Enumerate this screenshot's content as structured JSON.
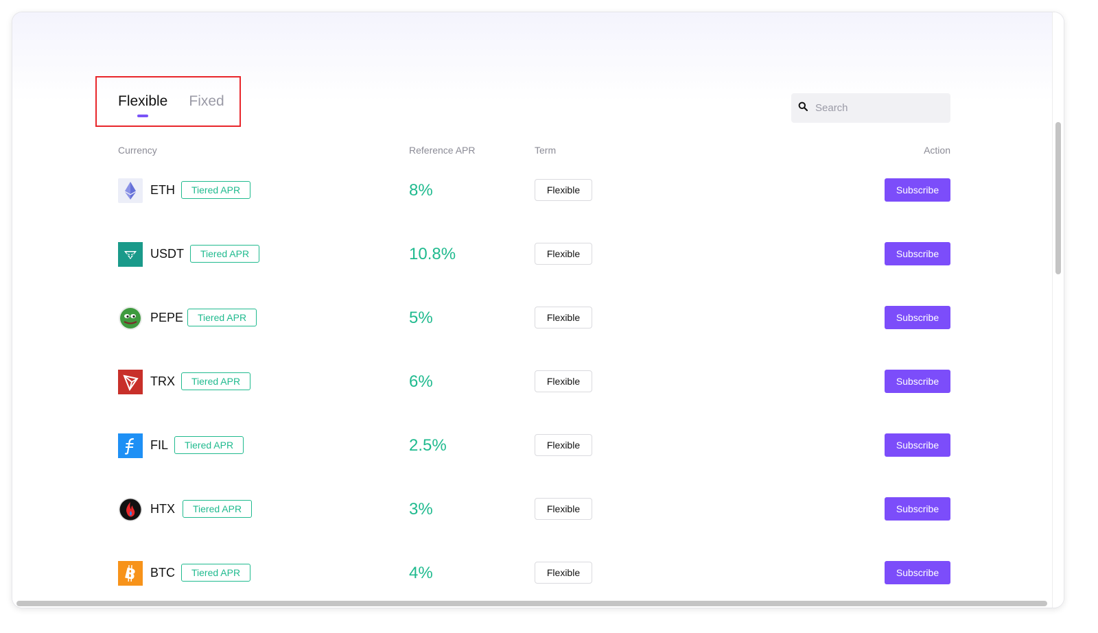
{
  "tabs": {
    "items": [
      {
        "label": "Flexible",
        "active": true
      },
      {
        "label": "Fixed",
        "active": false
      }
    ]
  },
  "search": {
    "placeholder": "Search",
    "value": ""
  },
  "table": {
    "headers": {
      "currency": "Currency",
      "apr": "Reference APR",
      "term": "Term",
      "action": "Action"
    },
    "rows": [
      {
        "symbol": "ETH",
        "badge": "Tiered APR",
        "apr": "8%",
        "term": "Flexible",
        "action": "Subscribe",
        "icon": "eth-icon"
      },
      {
        "symbol": "USDT",
        "badge": "Tiered APR",
        "apr": "10.8%",
        "term": "Flexible",
        "action": "Subscribe",
        "icon": "usdt-icon"
      },
      {
        "symbol": "PEPE",
        "badge": "Tiered APR",
        "apr": "5%",
        "term": "Flexible",
        "action": "Subscribe",
        "icon": "pepe-icon"
      },
      {
        "symbol": "TRX",
        "badge": "Tiered APR",
        "apr": "6%",
        "term": "Flexible",
        "action": "Subscribe",
        "icon": "trx-icon"
      },
      {
        "symbol": "FIL",
        "badge": "Tiered APR",
        "apr": "2.5%",
        "term": "Flexible",
        "action": "Subscribe",
        "icon": "fil-icon"
      },
      {
        "symbol": "HTX",
        "badge": "Tiered APR",
        "apr": "3%",
        "term": "Flexible",
        "action": "Subscribe",
        "icon": "htx-icon"
      },
      {
        "symbol": "BTC",
        "badge": "Tiered APR",
        "apr": "4%",
        "term": "Flexible",
        "action": "Subscribe",
        "icon": "btc-icon"
      }
    ]
  },
  "colors": {
    "accent": "#7c4dfa",
    "apr_green": "#1fba8e",
    "highlight_red": "#e8252a"
  }
}
